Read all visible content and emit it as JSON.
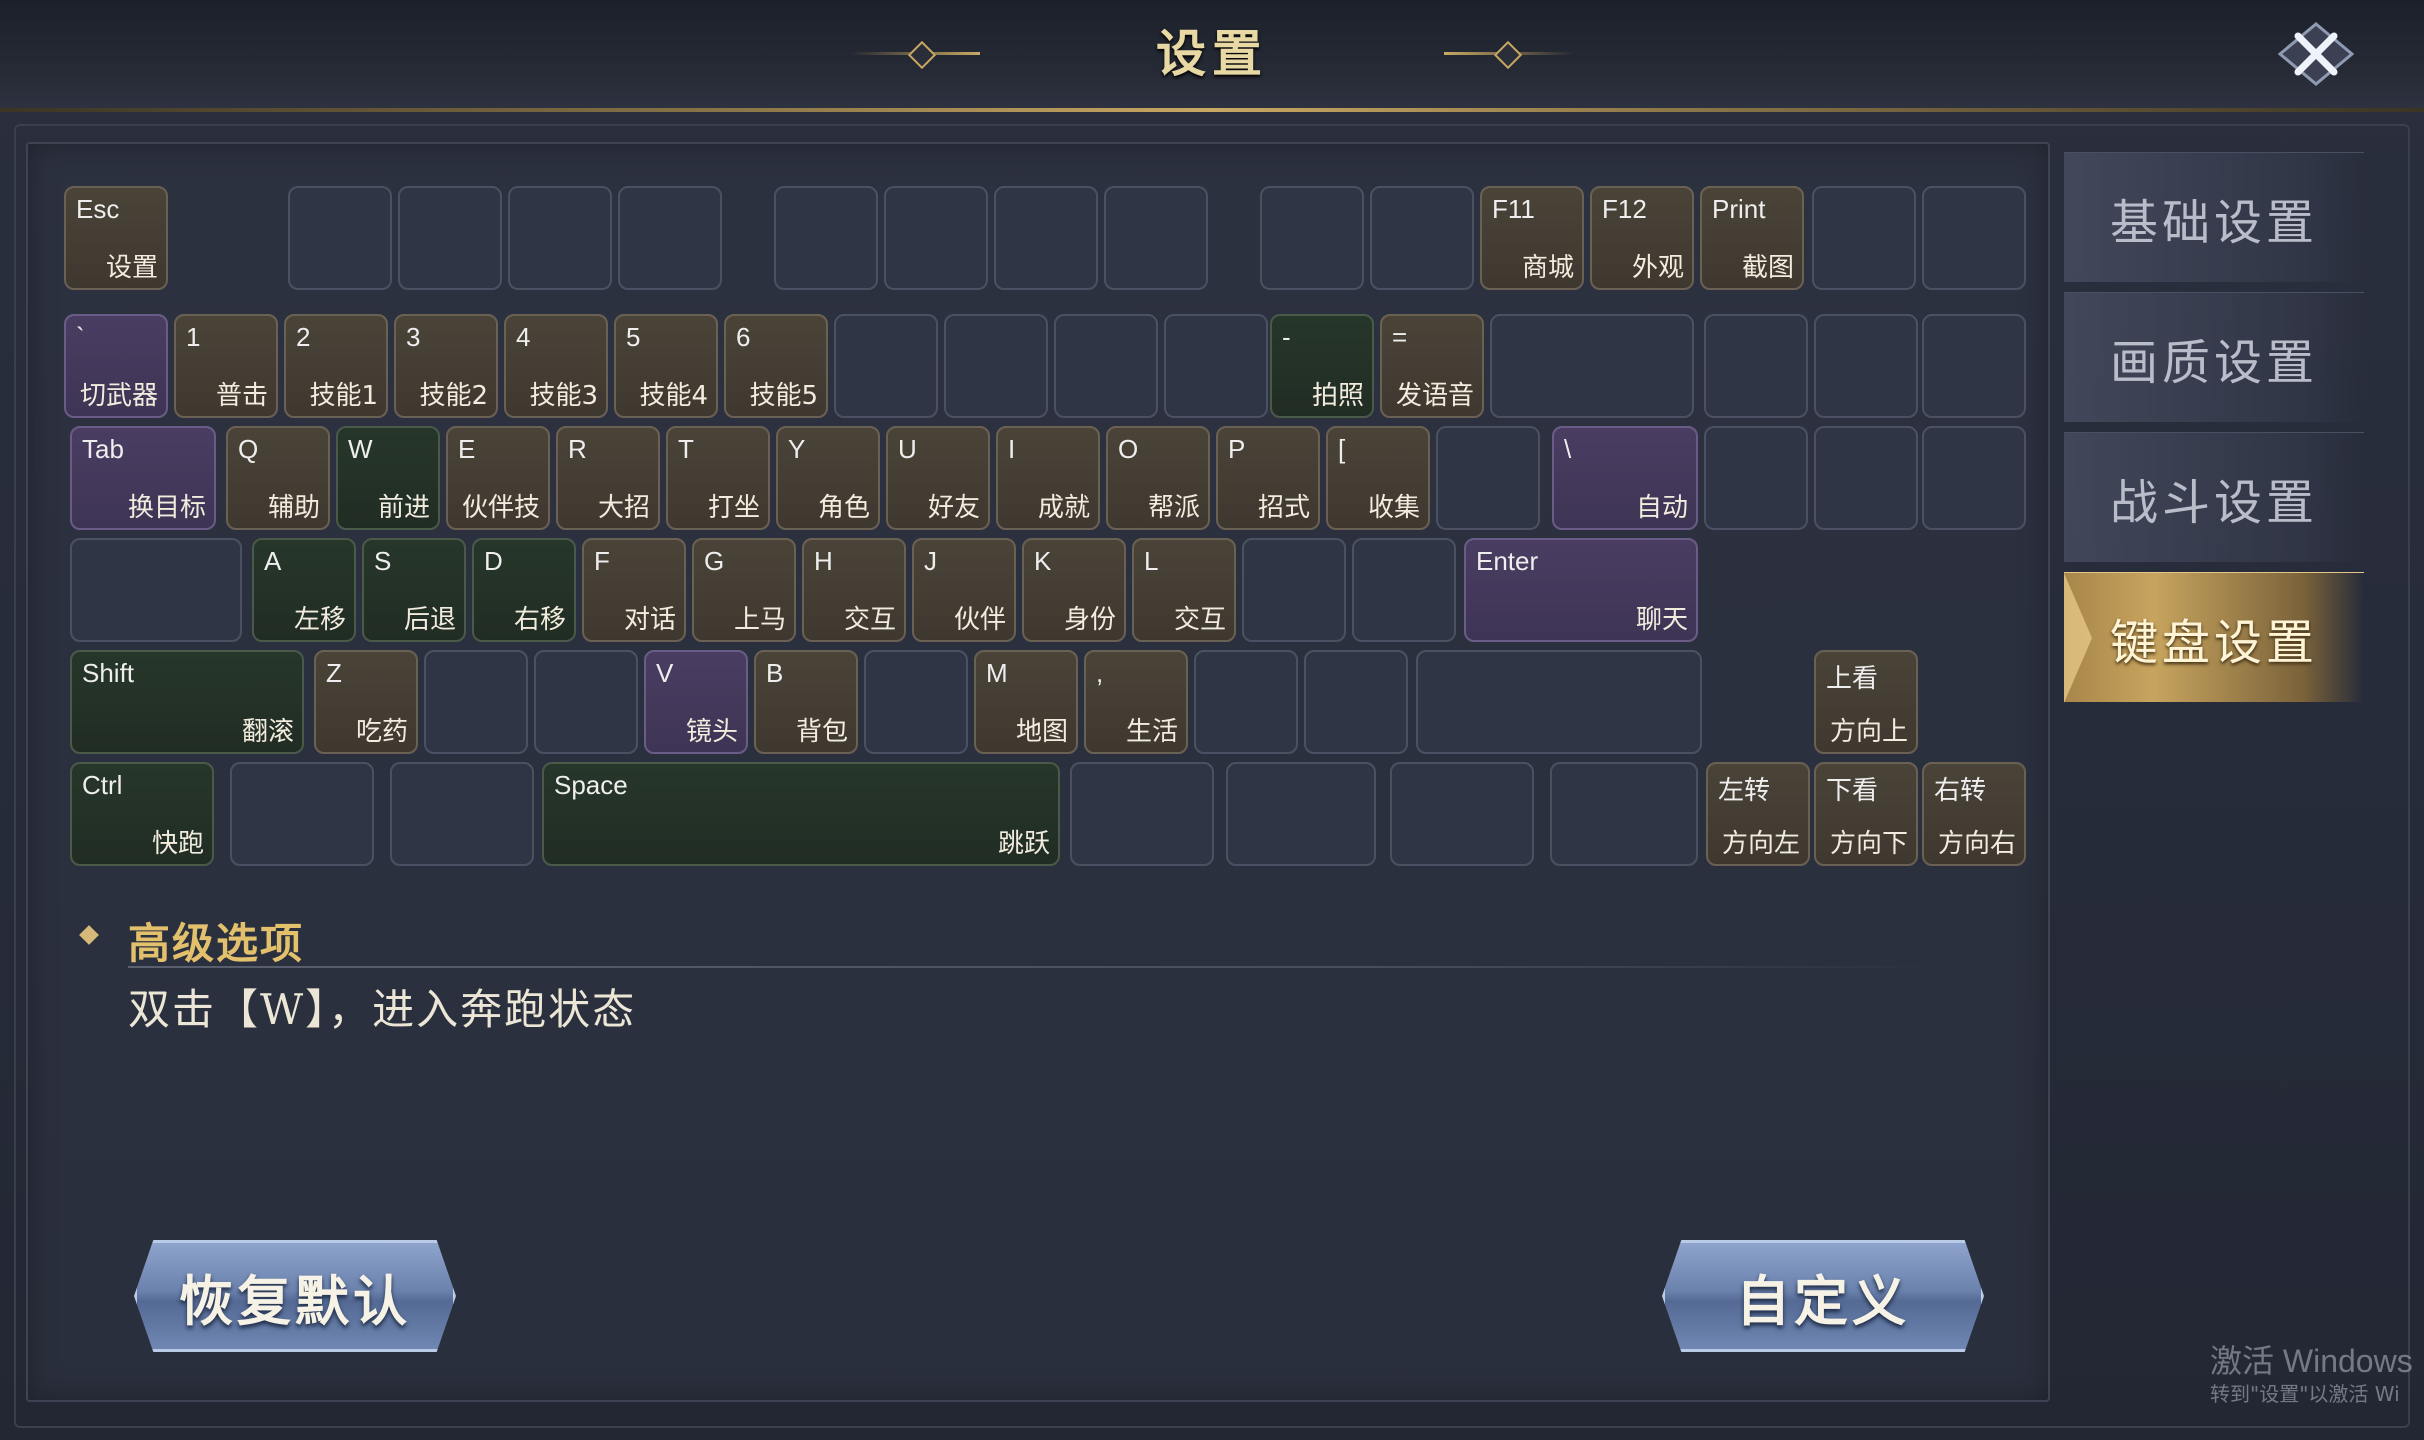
{
  "window": {
    "title": "设置"
  },
  "tabs": [
    {
      "label": "基础设置",
      "active": false
    },
    {
      "label": "画质设置",
      "active": false
    },
    {
      "label": "战斗设置",
      "active": false
    },
    {
      "label": "键盘设置",
      "active": true
    }
  ],
  "keyboard": {
    "rows": [
      [
        {
          "key": "Esc",
          "action": "设置",
          "type": "brown"
        },
        {
          "key": "",
          "action": "",
          "type": "empty"
        },
        {
          "key": "",
          "action": "",
          "type": "empty"
        },
        {
          "key": "",
          "action": "",
          "type": "empty"
        },
        {
          "key": "",
          "action": "",
          "type": "empty"
        },
        {
          "key": "",
          "action": "",
          "type": "empty"
        },
        {
          "key": "",
          "action": "",
          "type": "empty"
        },
        {
          "key": "",
          "action": "",
          "type": "empty"
        },
        {
          "key": "",
          "action": "",
          "type": "empty"
        },
        {
          "key": "",
          "action": "",
          "type": "empty"
        },
        {
          "key": "",
          "action": "",
          "type": "empty"
        },
        {
          "key": "F11",
          "action": "商城",
          "type": "brown"
        },
        {
          "key": "F12",
          "action": "外观",
          "type": "brown"
        },
        {
          "key": "Print",
          "action": "截图",
          "type": "brown"
        },
        {
          "key": "",
          "action": "",
          "type": "empty"
        },
        {
          "key": "",
          "action": "",
          "type": "empty"
        }
      ],
      [
        {
          "key": "`",
          "action": "切武器",
          "type": "purple"
        },
        {
          "key": "1",
          "action": "普击",
          "type": "brown"
        },
        {
          "key": "2",
          "action": "技能1",
          "type": "brown"
        },
        {
          "key": "3",
          "action": "技能2",
          "type": "brown"
        },
        {
          "key": "4",
          "action": "技能3",
          "type": "brown"
        },
        {
          "key": "5",
          "action": "技能4",
          "type": "brown"
        },
        {
          "key": "6",
          "action": "技能5",
          "type": "brown"
        },
        {
          "key": "",
          "action": "",
          "type": "empty"
        },
        {
          "key": "",
          "action": "",
          "type": "empty"
        },
        {
          "key": "",
          "action": "",
          "type": "empty"
        },
        {
          "key": "",
          "action": "",
          "type": "empty"
        },
        {
          "key": "-",
          "action": "拍照",
          "type": "green"
        },
        {
          "key": "=",
          "action": "发语音",
          "type": "brown"
        },
        {
          "key": "",
          "action": "",
          "type": "empty"
        },
        {
          "key": "",
          "action": "",
          "type": "empty"
        },
        {
          "key": "",
          "action": "",
          "type": "empty"
        },
        {
          "key": "",
          "action": "",
          "type": "empty"
        }
      ],
      [
        {
          "key": "Tab",
          "action": "换目标",
          "type": "purple"
        },
        {
          "key": "Q",
          "action": "辅助",
          "type": "brown"
        },
        {
          "key": "W",
          "action": "前进",
          "type": "green"
        },
        {
          "key": "E",
          "action": "伙伴技",
          "type": "brown"
        },
        {
          "key": "R",
          "action": "大招",
          "type": "brown"
        },
        {
          "key": "T",
          "action": "打坐",
          "type": "brown"
        },
        {
          "key": "Y",
          "action": "角色",
          "type": "brown"
        },
        {
          "key": "U",
          "action": "好友",
          "type": "brown"
        },
        {
          "key": "I",
          "action": "成就",
          "type": "brown"
        },
        {
          "key": "O",
          "action": "帮派",
          "type": "brown"
        },
        {
          "key": "P",
          "action": "招式",
          "type": "brown"
        },
        {
          "key": "[",
          "action": "收集",
          "type": "brown"
        },
        {
          "key": "",
          "action": "",
          "type": "empty"
        },
        {
          "key": "\\",
          "action": "自动",
          "type": "purple"
        },
        {
          "key": "",
          "action": "",
          "type": "empty"
        },
        {
          "key": "",
          "action": "",
          "type": "empty"
        },
        {
          "key": "",
          "action": "",
          "type": "empty"
        }
      ],
      [
        {
          "key": "",
          "action": "",
          "type": "empty"
        },
        {
          "key": "A",
          "action": "左移",
          "type": "green"
        },
        {
          "key": "S",
          "action": "后退",
          "type": "green"
        },
        {
          "key": "D",
          "action": "右移",
          "type": "green"
        },
        {
          "key": "F",
          "action": "对话",
          "type": "brown"
        },
        {
          "key": "G",
          "action": "上马",
          "type": "brown"
        },
        {
          "key": "H",
          "action": "交互",
          "type": "brown"
        },
        {
          "key": "J",
          "action": "伙伴",
          "type": "brown"
        },
        {
          "key": "K",
          "action": "身份",
          "type": "brown"
        },
        {
          "key": "L",
          "action": "交互",
          "type": "brown"
        },
        {
          "key": "",
          "action": "",
          "type": "empty"
        },
        {
          "key": "",
          "action": "",
          "type": "empty"
        },
        {
          "key": "Enter",
          "action": "聊天",
          "type": "purple"
        }
      ],
      [
        {
          "key": "Shift",
          "action": "翻滚",
          "type": "green"
        },
        {
          "key": "Z",
          "action": "吃药",
          "type": "brown"
        },
        {
          "key": "",
          "action": "",
          "type": "empty"
        },
        {
          "key": "",
          "action": "",
          "type": "empty"
        },
        {
          "key": "V",
          "action": "镜头",
          "type": "purple"
        },
        {
          "key": "B",
          "action": "背包",
          "type": "brown"
        },
        {
          "key": "",
          "action": "",
          "type": "empty"
        },
        {
          "key": "M",
          "action": "地图",
          "type": "brown"
        },
        {
          "key": ",",
          "action": "生活",
          "type": "brown"
        },
        {
          "key": "",
          "action": "",
          "type": "empty"
        },
        {
          "key": "",
          "action": "",
          "type": "empty"
        },
        {
          "key": "",
          "action": "",
          "type": "empty"
        },
        {
          "key": "上看",
          "action": "方向上",
          "type": "brown"
        }
      ],
      [
        {
          "key": "Ctrl",
          "action": "快跑",
          "type": "green"
        },
        {
          "key": "",
          "action": "",
          "type": "empty"
        },
        {
          "key": "",
          "action": "",
          "type": "empty"
        },
        {
          "key": "Space",
          "action": "跳跃",
          "type": "green"
        },
        {
          "key": "",
          "action": "",
          "type": "empty"
        },
        {
          "key": "",
          "action": "",
          "type": "empty"
        },
        {
          "key": "",
          "action": "",
          "type": "empty"
        },
        {
          "key": "",
          "action": "",
          "type": "empty"
        },
        {
          "key": "左转",
          "action": "方向左",
          "type": "brown"
        },
        {
          "key": "下看",
          "action": "方向下",
          "type": "brown"
        },
        {
          "key": "右转",
          "action": "方向右",
          "type": "brown"
        }
      ]
    ]
  },
  "advanced": {
    "title": "高级选项",
    "description": "双击【W】，进入奔跑状态"
  },
  "buttons": {
    "restore_default": "恢复默认",
    "customize": "自定义"
  },
  "watermark": {
    "line1": "激活 Windows",
    "line2": "转到\"设置\"以激活 Wi"
  },
  "colors": {
    "accent_gold": "#e2c06c",
    "key_brown": "#4a4338",
    "key_green": "#27362a",
    "key_purple": "#4a3d62"
  }
}
